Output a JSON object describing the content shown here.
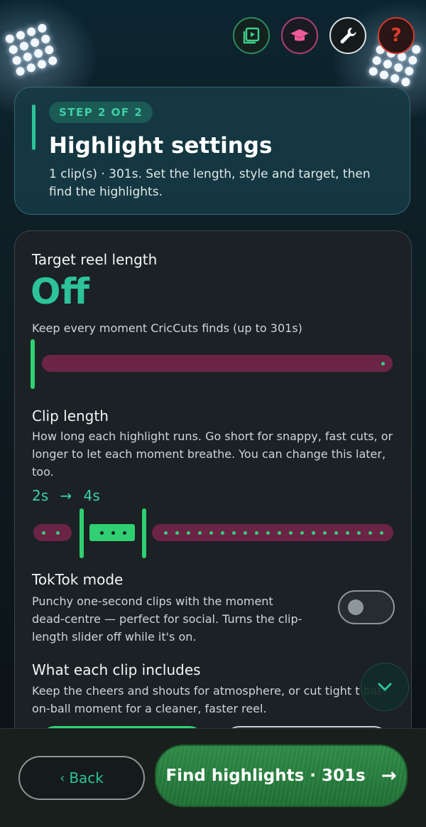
{
  "toolbar": {
    "video_icon": "play-library-icon",
    "learn_icon": "graduation-cap-icon",
    "tools_icon": "wrench-icon",
    "help_icon": "question-icon",
    "help_glyph": "?"
  },
  "header": {
    "step": "STEP 2 OF 2",
    "title": "Highlight settings",
    "subtitle": "1 clip(s) · 301s. Set the length, style and target, then find the highlights."
  },
  "target": {
    "title": "Target reel length",
    "value": "Off",
    "desc": "Keep every moment CricCuts finds (up to 301s)",
    "slider_fraction": 0
  },
  "clip_length": {
    "title": "Clip length",
    "desc": "How long each highlight runs. Go short for snappy, fast cuts, or longer to let each moment breathe. You can change this later, too.",
    "min": "2s",
    "arrow": "→",
    "max": "4s"
  },
  "toktok": {
    "title": "TokTok mode",
    "desc": "Punchy one-second clips with the moment dead-centre — perfect for social. Turns the clip-length slider off while it's on.",
    "enabled": false
  },
  "clip_includes": {
    "title": "What each clip includes",
    "desc": "Keep the cheers and shouts for atmosphere, or cut tight t bat-on-ball moment for a cleaner, faster reel."
  },
  "footer": {
    "back_chevron": "‹",
    "back": "Back",
    "find": "Find highlights · 301s",
    "find_arrow": "→"
  },
  "colors": {
    "accent": "#2cc39a",
    "slider_track": "#6b2446",
    "slider_active": "#2fcf72"
  }
}
